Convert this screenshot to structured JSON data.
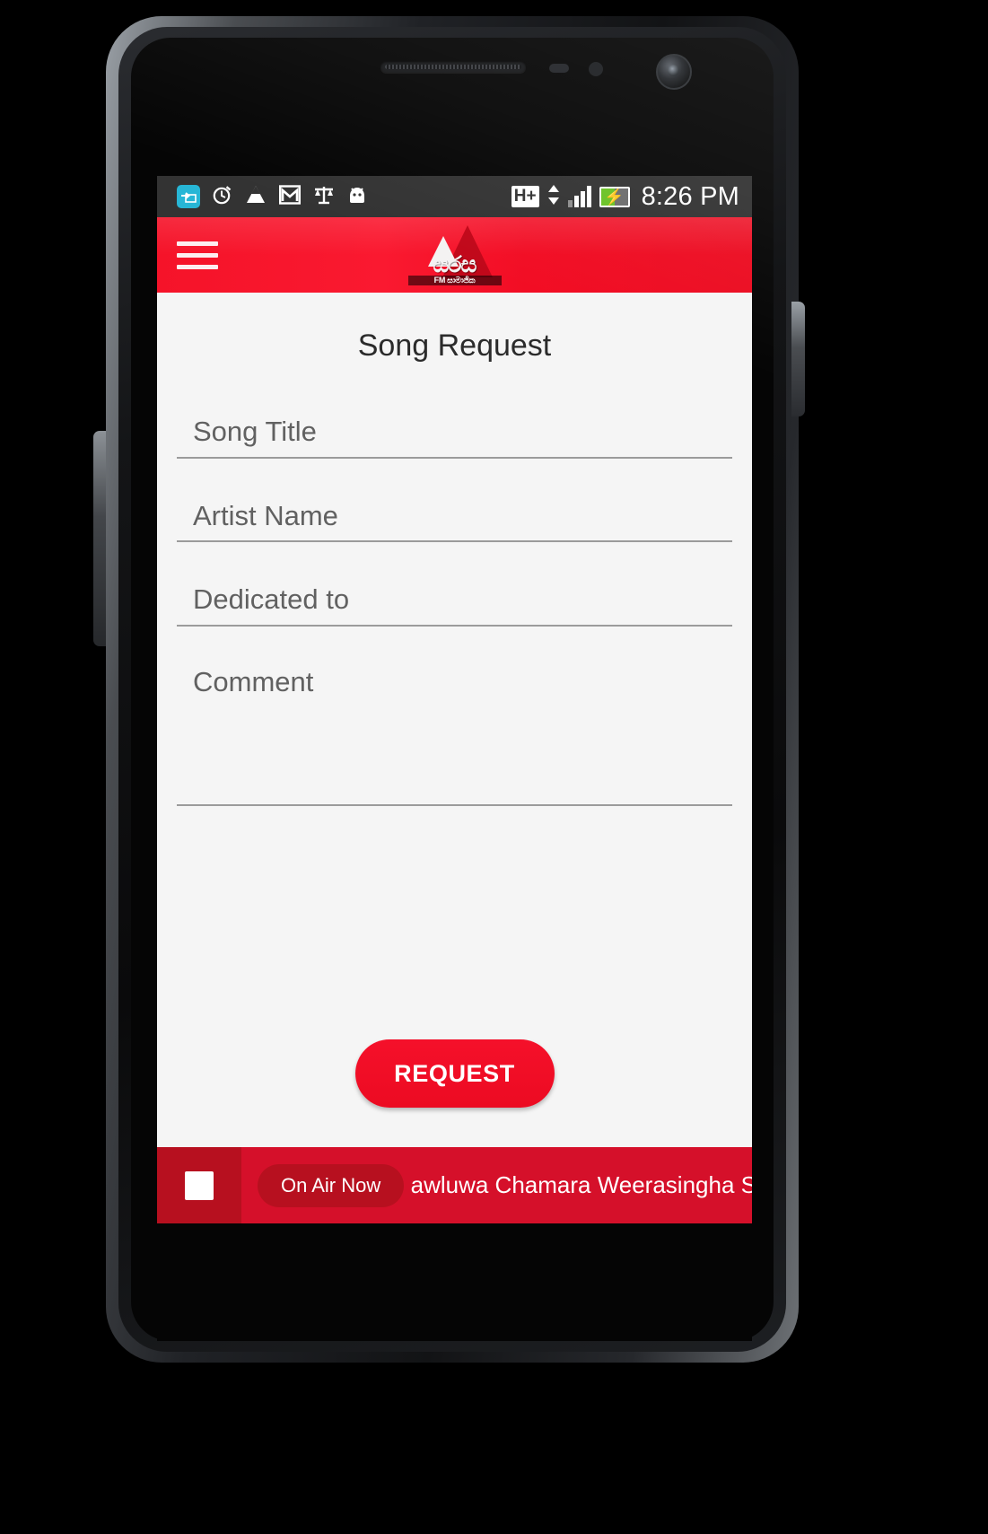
{
  "status_bar": {
    "icons": [
      {
        "name": "sync-icon",
        "glyph": "↴"
      },
      {
        "name": "alarm-icon",
        "glyph": "⏱"
      },
      {
        "name": "drive-icon",
        "glyph": "△"
      },
      {
        "name": "gmail-icon",
        "glyph": "M"
      },
      {
        "name": "balance-icon",
        "glyph": "⚖"
      },
      {
        "name": "bug-droid-icon",
        "glyph": "●"
      }
    ],
    "network_type": "H+",
    "time": "8:26 PM",
    "signal_bars": 3,
    "battery_charging": true,
    "battery_level_pct": 52
  },
  "app_bar": {
    "menu_label": "menu",
    "logo_text": "සරස",
    "logo_subtext": "FM සාමාජික"
  },
  "main": {
    "page_title": "Song Request",
    "fields": [
      {
        "name": "song-title",
        "placeholder": "Song Title",
        "value": ""
      },
      {
        "name": "artist-name",
        "placeholder": "Artist Name",
        "value": ""
      },
      {
        "name": "dedicated-to",
        "placeholder": "Dedicated to",
        "value": ""
      },
      {
        "name": "comment",
        "placeholder": "Comment",
        "value": ""
      }
    ],
    "submit_label": "REQUEST"
  },
  "player": {
    "stop_button_label": "stop",
    "on_air_label": "On Air Now",
    "now_playing": "Kawluwa Chamara Weerasingha Shashik"
  },
  "colors": {
    "brand_red": "#f5102a",
    "player_red": "#d5102a",
    "player_dark_red": "#b7101f",
    "status_bar": "#333333",
    "page_bg": "#f5f5f5",
    "field_line": "#9b9b9b",
    "placeholder_text": "#616161"
  }
}
